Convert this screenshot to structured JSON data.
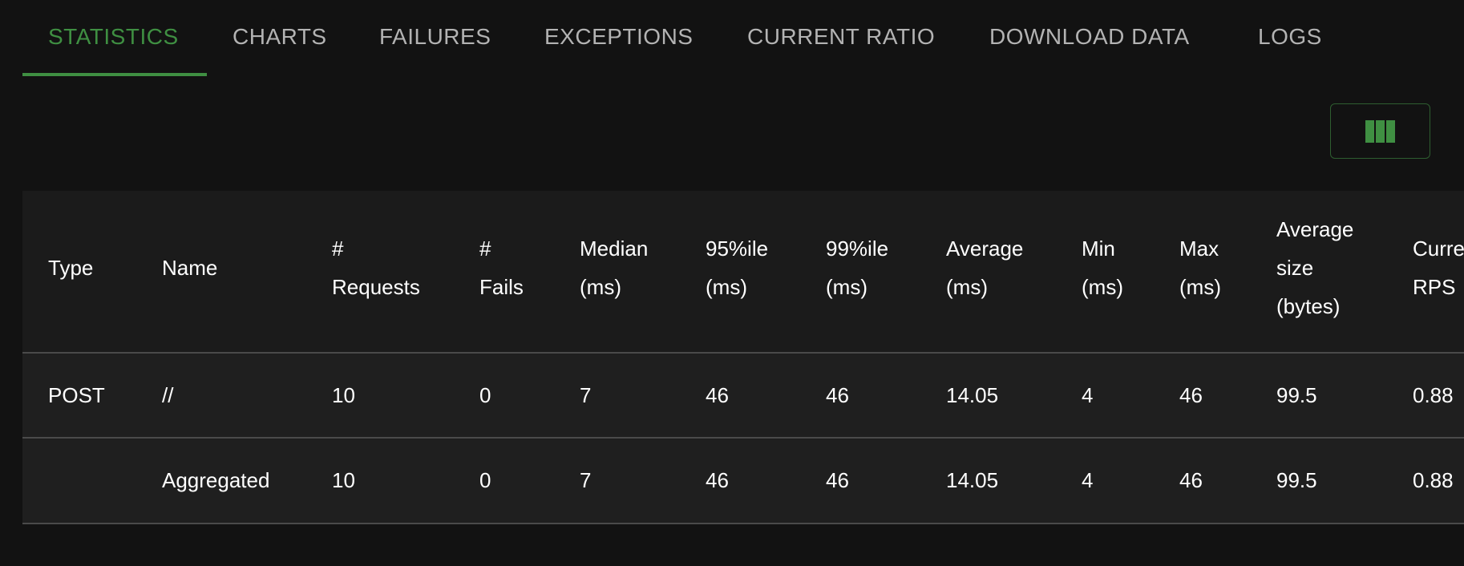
{
  "tabs": [
    {
      "label": "STATISTICS",
      "active": true
    },
    {
      "label": "CHARTS",
      "active": false
    },
    {
      "label": "FAILURES",
      "active": false
    },
    {
      "label": "EXCEPTIONS",
      "active": false
    },
    {
      "label": "CURRENT RATIO",
      "active": false
    },
    {
      "label": "DOWNLOAD DATA",
      "active": false
    },
    {
      "label": "LOGS",
      "active": false
    }
  ],
  "toolbar": {
    "columns_icon": "view-columns-icon"
  },
  "colors": {
    "accent": "#3f8f42",
    "background": "#121212",
    "table_bg": "#1f1f1f",
    "tab_inactive": "#b3b3b3"
  },
  "table": {
    "headers": [
      [
        "Type"
      ],
      [
        "Name"
      ],
      [
        "#",
        "Requests"
      ],
      [
        "#",
        "Fails"
      ],
      [
        "Median",
        "(ms)"
      ],
      [
        "95%ile",
        "(ms)"
      ],
      [
        "99%ile",
        "(ms)"
      ],
      [
        "Average",
        "(ms)"
      ],
      [
        "Min",
        "(ms)"
      ],
      [
        "Max",
        "(ms)"
      ],
      [
        "Average",
        "size",
        "(bytes)"
      ],
      [
        "Curre",
        "RPS"
      ]
    ],
    "rows": [
      [
        "POST",
        "//",
        "10",
        "0",
        "7",
        "46",
        "46",
        "14.05",
        "4",
        "46",
        "99.5",
        "0.88"
      ],
      [
        "",
        "Aggregated",
        "10",
        "0",
        "7",
        "46",
        "46",
        "14.05",
        "4",
        "46",
        "99.5",
        "0.88"
      ]
    ]
  }
}
